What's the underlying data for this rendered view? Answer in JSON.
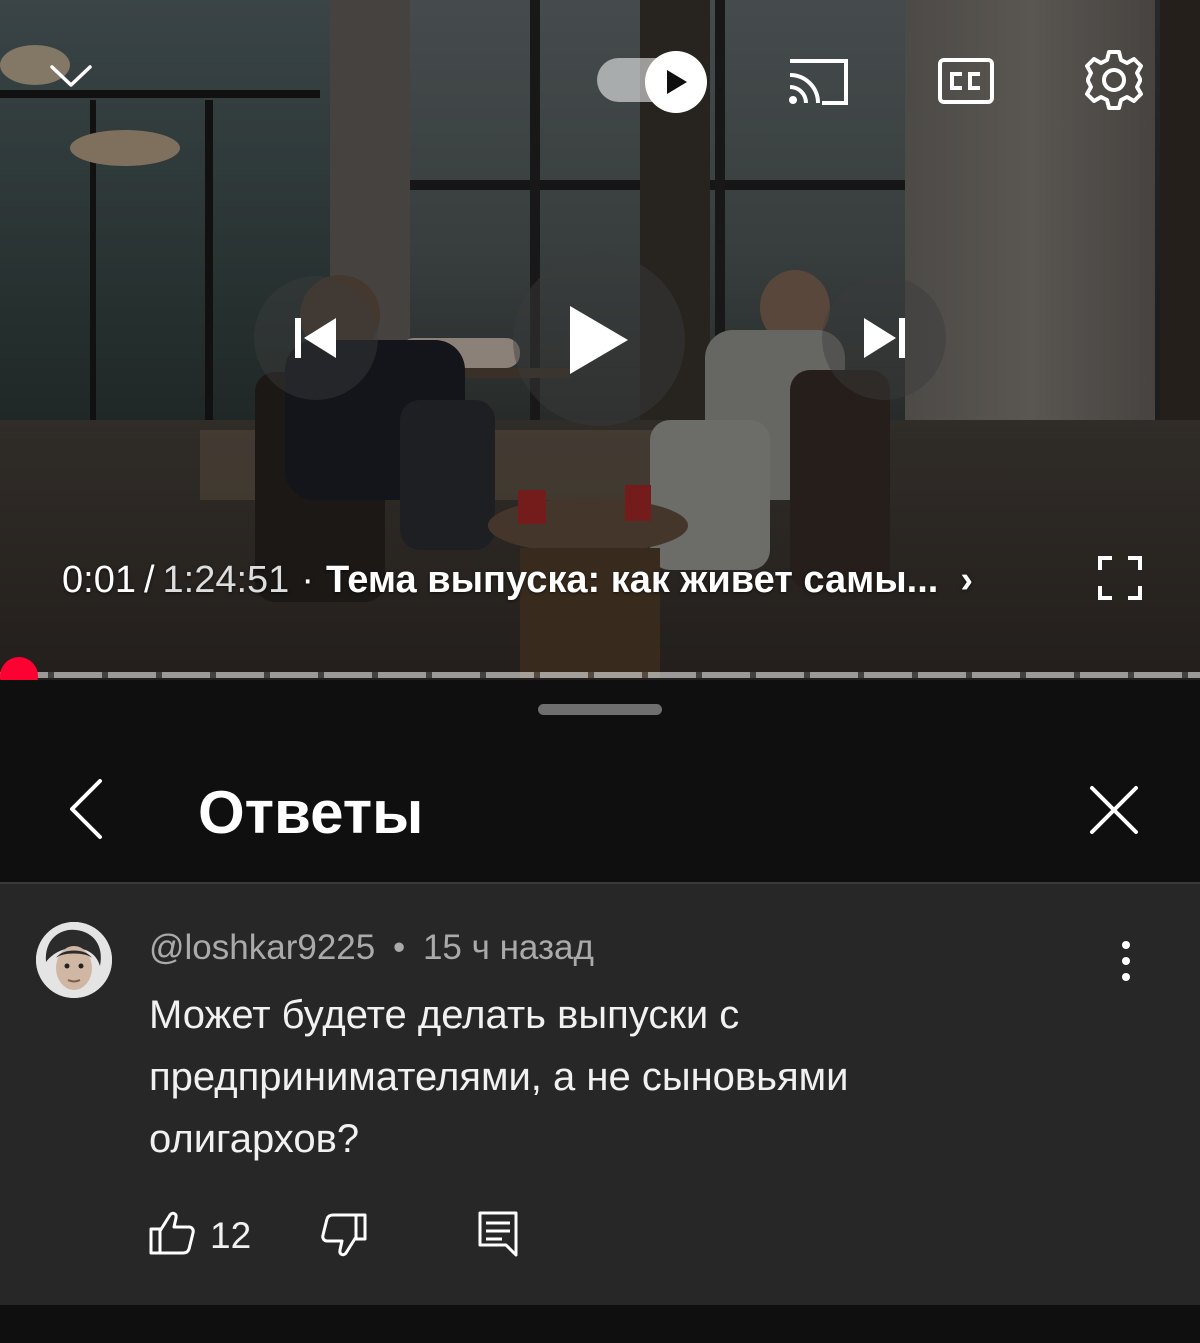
{
  "player": {
    "time_current": "0:01",
    "time_separator": "/",
    "time_total": "1:24:51",
    "dot": "·",
    "chapter_title": "Тема выпуска: как живет самы...",
    "chapter_chevron": "›",
    "progress_fraction": 0.0002,
    "accent_color": "#ff0033",
    "icons": [
      "chevron-down-icon",
      "autoplay-toggle",
      "cast-icon",
      "cc-icon",
      "gear-icon",
      "previous-icon",
      "play-icon",
      "next-icon",
      "fullscreen-icon"
    ]
  },
  "panel": {
    "title": "Ответы",
    "icons": [
      "back-icon",
      "close-icon"
    ]
  },
  "comment": {
    "author": "@loshkar9225",
    "meta_separator": "•",
    "time_ago": "15 ч назад",
    "text": "Может будете делать выпуски с предпринимателями, а не сыновьями олигархов?",
    "like_count": "12",
    "icons": [
      "like-icon",
      "dislike-icon",
      "reply-icon",
      "more-vertical-icon"
    ]
  }
}
